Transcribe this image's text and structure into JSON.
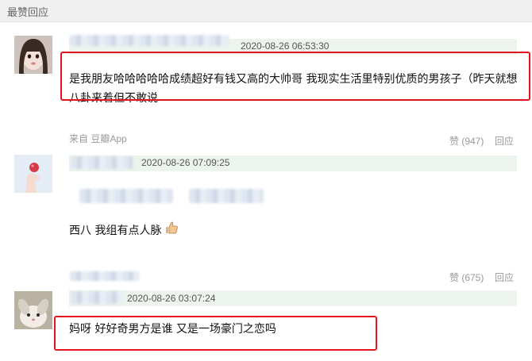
{
  "section": {
    "title": "最赞回应"
  },
  "comments": [
    {
      "timestamp": "2020-08-26 06:53:30",
      "text": "是我朋友哈哈哈哈哈成绩超好有钱又高的大帅哥 我现实生活里特别优质的男孩子（昨天就想八卦来着但不敢说",
      "source": "来自 豆瓣App",
      "like_label": "赞 (947)",
      "reply_label": "回应"
    },
    {
      "timestamp": "2020-08-26 07:09:25",
      "text": "西八 我组有点人脉",
      "emoji": "thumbs-up-icon",
      "like_label": "赞 (675)",
      "reply_label": "回应"
    },
    {
      "timestamp": "2020-08-26 03:07:24",
      "text": "妈呀 好好奇男方是谁 又是一场豪门之恋吗"
    }
  ],
  "colors": {
    "highlight_border": "#e3141f",
    "meta_bar": "#edf4ed",
    "header_bg": "#f0f0f0",
    "muted_text": "#999999"
  }
}
